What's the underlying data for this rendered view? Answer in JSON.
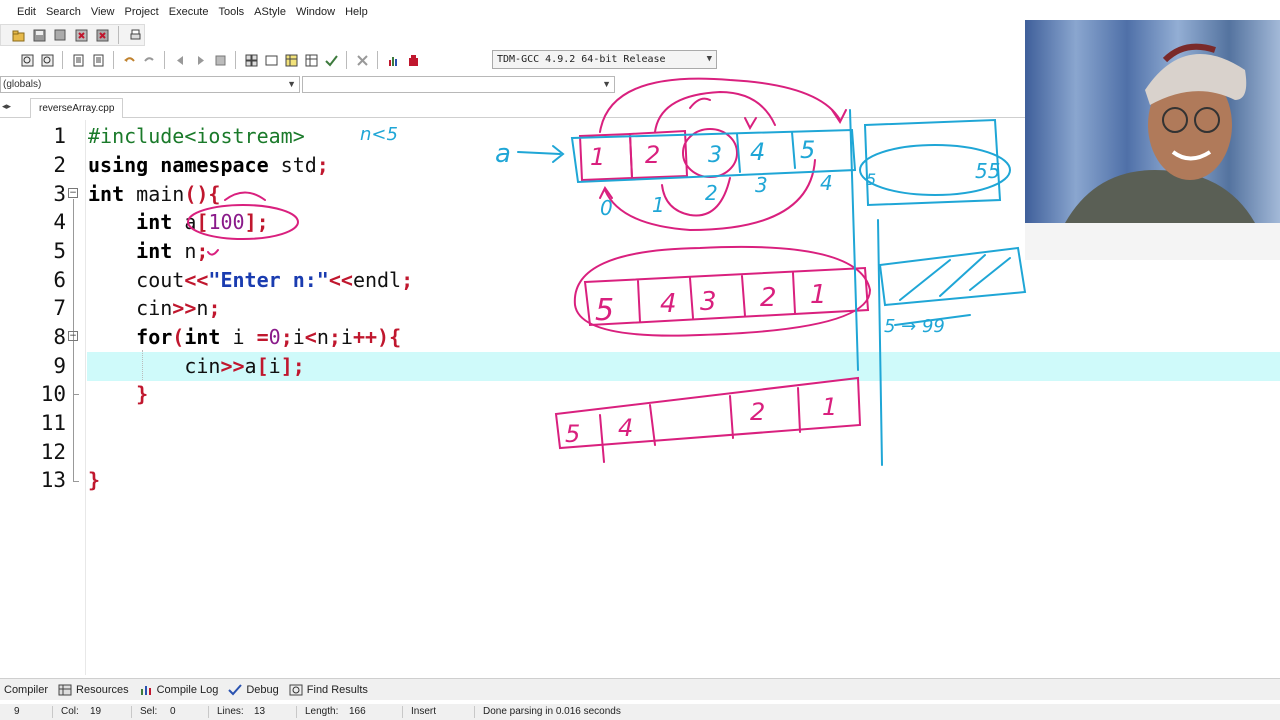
{
  "menu": {
    "items": [
      "Edit",
      "Search",
      "View",
      "Project",
      "Execute",
      "Tools",
      "AStyle",
      "Window",
      "Help"
    ]
  },
  "toolbar": {
    "compiler": "TDM-GCC 4.9.2 64-bit Release"
  },
  "scope": {
    "left": "(globals)"
  },
  "tabs": {
    "file": "reverseArray.cpp"
  },
  "editor": {
    "line_numbers": [
      "1",
      "2",
      "3",
      "4",
      "5",
      "6",
      "7",
      "8",
      "9",
      "10",
      "11",
      "12",
      "13"
    ],
    "lines": {
      "l1": "#include<iostream>",
      "l2a": "using namespace",
      "l2b": " std",
      "l2c": ";",
      "l3a": "int",
      "l3b": " main",
      "l3c": "(){",
      "l4a": "    int",
      "l4b": " a",
      "l4c": "[",
      "l4d": "100",
      "l4e": "];",
      "l5a": "    int",
      "l5b": " n",
      "l5c": ";",
      "l6a": "    cout",
      "l6b": "<<",
      "l6c": "\"Enter n:\"",
      "l6d": "<<",
      "l6e": "endl",
      "l6f": ";",
      "l7a": "    cin",
      "l7b": ">>",
      "l7c": "n",
      "l7d": ";",
      "l8a": "    for",
      "l8b": "(",
      "l8c": "int",
      "l8d": " i ",
      "l8e": "=",
      "l8f": "0",
      "l8g": ";",
      "l8h": "i",
      "l8i": "<",
      "l8j": "n",
      "l8k": ";",
      "l8l": "i",
      "l8m": "++){",
      "l9a": "        cin",
      "l9b": ">>",
      "l9c": "a",
      "l9d": "[",
      "l9e": "i",
      "l9f": "];",
      "l10": "    }",
      "l13": "}"
    }
  },
  "bottom_tabs": {
    "compiler": "Compiler",
    "resources": "Resources",
    "compile_log": "Compile Log",
    "debug": "Debug",
    "find_results": "Find Results"
  },
  "status": {
    "line": "9",
    "col_label": "Col:",
    "col": "19",
    "sel_label": "Sel:",
    "sel": "0",
    "lines_label": "Lines:",
    "lines": "13",
    "length_label": "Length:",
    "length": "166",
    "mode": "Insert",
    "message": "Done parsing in 0.016 seconds"
  },
  "annotations": {
    "n_note": "n<5",
    "a_label": "a",
    "array_top": [
      "1",
      "2",
      "3",
      "4",
      "5"
    ],
    "array_top_indices": [
      "0",
      "1",
      "2",
      "3",
      "4"
    ],
    "reversed": [
      "5",
      "4",
      "3",
      "2",
      "1"
    ],
    "partial": [
      "5",
      "4",
      "2",
      "1"
    ],
    "mid_under": "2",
    "side_left": "5",
    "side_right": "55",
    "range": "5 → 99"
  },
  "colors": {
    "pen_cyan": "#1fa6d6",
    "pen_magenta": "#d9207e",
    "current_line": "#cffafa"
  }
}
